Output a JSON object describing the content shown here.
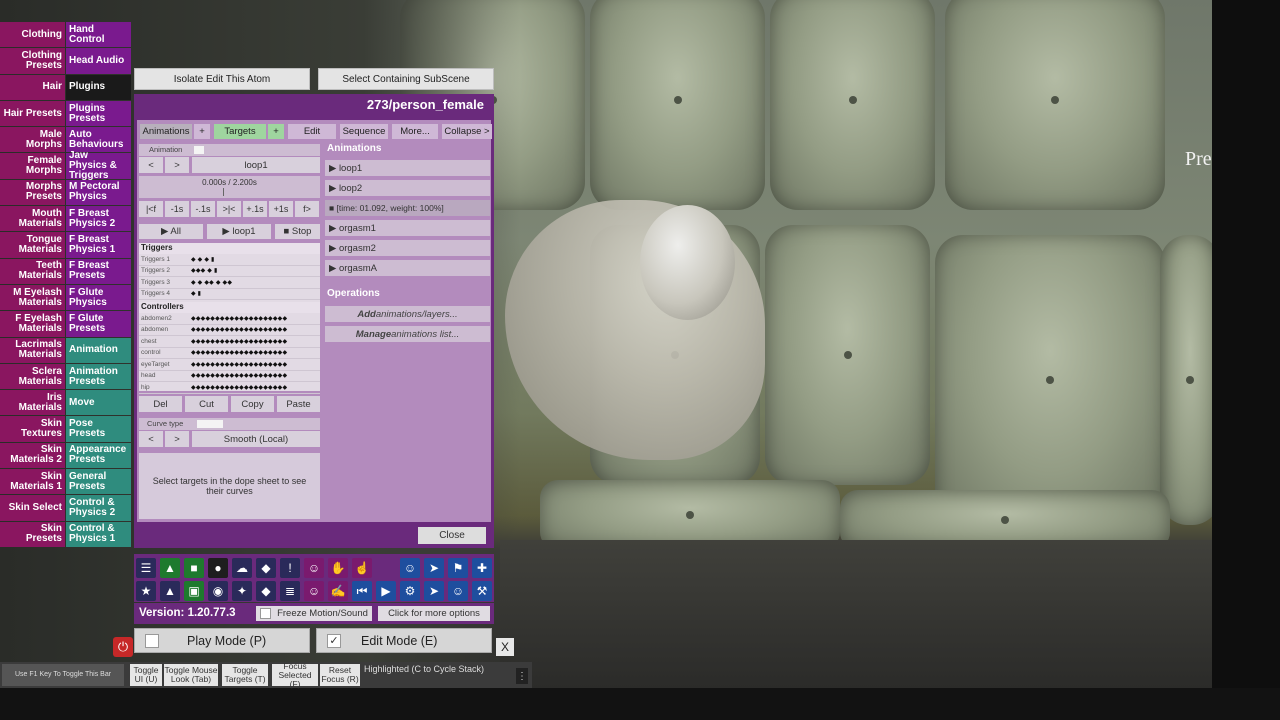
{
  "scene": {
    "overlay_text": "Pres"
  },
  "left_menu": [
    [
      "Clothing",
      "Hand Control"
    ],
    [
      "Clothing Presets",
      "Head Audio"
    ],
    [
      "Hair",
      "Plugins"
    ],
    [
      "Hair Presets",
      "Plugins Presets"
    ],
    [
      "Male Morphs",
      "Auto Behaviours"
    ],
    [
      "Female Morphs",
      "Jaw Physics & Triggers"
    ],
    [
      "Morphs Presets",
      "M Pectoral Physics"
    ],
    [
      "Mouth Materials",
      "F Breast Physics 2"
    ],
    [
      "Tongue Materials",
      "F Breast Physics 1"
    ],
    [
      "Teeth Materials",
      "F Breast Presets"
    ],
    [
      "M Eyelash Materials",
      "F Glute Physics"
    ],
    [
      "F Eyelash Materials",
      "F Glute Presets"
    ],
    [
      "Lacrimals Materials",
      "Animation"
    ],
    [
      "Sclera Materials",
      "Animation Presets"
    ],
    [
      "Iris Materials",
      "Move"
    ],
    [
      "Skin Textures",
      "Pose Presets"
    ],
    [
      "Skin Materials 2",
      "Appearance Presets"
    ],
    [
      "Skin Materials 1",
      "General Presets"
    ],
    [
      "Skin Select",
      "Control & Physics 2"
    ],
    [
      "Skin Presets",
      "Control & Physics 1"
    ]
  ],
  "top_buttons": {
    "isolate": "Isolate Edit This Atom",
    "select_subscene": "Select Containing SubScene"
  },
  "panel": {
    "title": "273/person_female",
    "tabs": {
      "animations": "Animations",
      "plus1": "+",
      "targets": "Targets",
      "plus2": "+",
      "edit": "Edit",
      "sequence": "Sequence",
      "more": "More...",
      "collapse": "Collapse >"
    },
    "animation_label": "Animation",
    "prev": "<",
    "next": ">",
    "current_animation": "loop1",
    "time_display": "0.000s / 2.200s",
    "scrub_buttons": [
      "|<f",
      "-1s",
      "-.1s",
      ">|<",
      "+.1s",
      "+1s",
      "f>"
    ],
    "play_all": "▶ All",
    "play_current": "▶ loop1",
    "stop": "■ Stop",
    "triggers_header": "Triggers",
    "triggers": [
      {
        "label": "Triggers 1",
        "keys": "◆     ◆           ◆                                   ▮"
      },
      {
        "label": "Triggers 2",
        "keys": "◆◆◆                             ◆                   ▮"
      },
      {
        "label": "Triggers 3",
        "keys": "◆          ◆   ◆◆          ◆                  ◆◆"
      },
      {
        "label": "Triggers 4",
        "keys": "◆                                                          ▮"
      }
    ],
    "controllers_header": "Controllers",
    "controllers": [
      {
        "label": "abdomen2",
        "keys": "◆◆◆◆◆◆◆◆◆◆◆◆◆◆◆◆◆◆◆◆"
      },
      {
        "label": "abdomen",
        "keys": "◆◆◆◆◆◆◆◆◆◆◆◆◆◆◆◆◆◆◆◆"
      },
      {
        "label": "chest",
        "keys": "◆◆◆◆◆◆◆◆◆◆◆◆◆◆◆◆◆◆◆◆"
      },
      {
        "label": "control",
        "keys": "◆◆◆◆◆◆◆◆◆◆◆◆◆◆◆◆◆◆◆◆"
      },
      {
        "label": "eyeTarget",
        "keys": "◆◆◆◆◆◆◆◆◆◆◆◆◆◆◆◆◆◆◆◆"
      },
      {
        "label": "head",
        "keys": "◆◆◆◆◆◆◆◆◆◆◆◆◆◆◆◆◆◆◆◆"
      },
      {
        "label": "hip",
        "keys": "◆◆◆◆◆◆◆◆◆◆◆◆◆◆◆◆◆◆◆◆"
      }
    ],
    "edit_buttons": [
      "Del",
      "Cut",
      "Copy",
      "Paste"
    ],
    "curve_type_label": "Curve type",
    "curve_type_value": "Smooth (Local)",
    "hint": "Select targets in the dope sheet to see their curves",
    "animations_header": "Animations",
    "animations": [
      "▶ loop1",
      "▶ loop2"
    ],
    "animation_status": "■ [time: 01.092, weight: 100%]",
    "animations_more": [
      "▶ orgasm1",
      "▶ orgasm2",
      "▶ orgasmA"
    ],
    "operations_header": "Operations",
    "op_add_bold": "Add",
    "op_add_rest": " animations/layers...",
    "op_manage_bold": "Manage",
    "op_manage_rest": " animations list...",
    "close": "Close"
  },
  "toolbar": {
    "row1": [
      "☰",
      "▲",
      "■",
      "●",
      "☁",
      "◆",
      "!",
      "☺",
      "✋",
      "☝",
      "",
      "☺",
      "➤",
      "⚑",
      "✚"
    ],
    "row2": [
      "★",
      "▲",
      "▣",
      "◉",
      "✦",
      "◆",
      "≣",
      "☺",
      "✍",
      "⏮",
      "▶",
      "⚙",
      "➤",
      "☺",
      "⚒"
    ]
  },
  "version": "Version: 1.20.77.3",
  "freeze_label": "Freeze Motion/Sound",
  "more_options": "Click for more options",
  "play_mode": "Play Mode (P)",
  "edit_mode": "Edit Mode (E)",
  "edit_check": "✓",
  "x_label": "X",
  "power_icon": "⏻",
  "bottom_bar": {
    "f1_hint": "Use F1 Key To Toggle This Bar",
    "toggle_ui": "Toggle UI (U)",
    "toggle_mouse": "Toggle Mouse Look (Tab)",
    "toggle_targets": "Toggle Targets (T)",
    "focus_selected": "Focus Selected (F)",
    "reset_focus": "Reset Focus (R)",
    "highlighted": "Highlighted (C to Cycle Stack)",
    "dots": "⋮"
  }
}
